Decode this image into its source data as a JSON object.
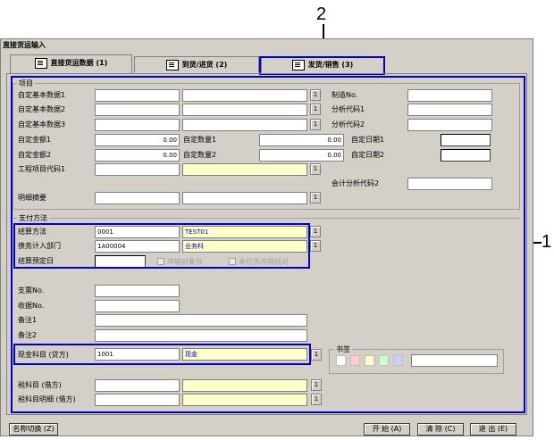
{
  "window": {
    "title": "直接货运输入"
  },
  "tabs": [
    {
      "label": "直接货运数据 (1)"
    },
    {
      "label": "到货/进货 (2)"
    },
    {
      "label": "发货/销售 (3)"
    }
  ],
  "callouts": {
    "two": "2",
    "one": "1"
  },
  "items_group": {
    "title": "项目",
    "fields": {
      "custom_base1": "自定基本数据1",
      "custom_base2": "自定基本数据2",
      "custom_base3": "自定基本数据3",
      "custom_amount1": "自定金额1",
      "custom_amount2": "自定金额2",
      "project_code1": "工程项目代码1",
      "detail_summary": "明细摘要",
      "custom_qty1": "自定数量1",
      "custom_qty2": "自定数量2",
      "custom_date1": "自定日期1",
      "custom_date2": "自定日期2",
      "manufacture_no": "制造No.",
      "analysis_code1": "分析代码1",
      "analysis_code2": "分析代码2",
      "acct_analysis_code2": "会计分析代码2"
    },
    "values": {
      "amount1": "0.00",
      "amount2": "0.00",
      "qty1": "0.00",
      "qty2": "0.00"
    },
    "picker": "1"
  },
  "payment_group": {
    "title": "支付方法",
    "settlement_method_label": "结算方法",
    "settlement_method_code": "0001",
    "settlement_method_name": "TEST01",
    "debt_dept_label": "债务计入部门",
    "debt_dept_code": "1A00004",
    "debt_dept_name": "业务科",
    "settlement_date_label": "结算预定日",
    "checkbox_offset": "冲销对象外",
    "checkbox_local": "本位币冲销核对",
    "check_no_label": "支票No.",
    "receipt_no_label": "收据No.",
    "note1_label": "备注1",
    "note2_label": "备注2",
    "cash_account_label": "现金科目 (贷方)",
    "cash_account_code": "1001",
    "cash_account_name": "现金",
    "tax_account_label": "税科目 (借方)",
    "tax_detail_label": "税科目明细 (借方)",
    "bookmark_label": "书签"
  },
  "bookmark_colors": [
    "#ffffff",
    "#ffcccc",
    "#ffffcc",
    "#ccffcc",
    "#ccccff"
  ],
  "bottom": {
    "name_switch": "名称切换 (Z)",
    "start": "开 始 (A)",
    "clear": "清 除 (C)",
    "exit": "退 出 (E)"
  },
  "colors": {
    "highlight": "#0000cc",
    "window_bg": "#d4d0c8",
    "input_yellow": "#ffffcc"
  }
}
